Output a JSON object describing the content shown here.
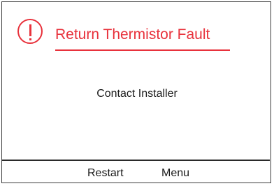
{
  "alert": {
    "icon": "exclamation-circle-icon",
    "title": "Return Thermistor Fault",
    "color": "#e8323c"
  },
  "message": "Contact Installer",
  "softkeys": {
    "restart_label": "Restart",
    "menu_label": "Menu"
  }
}
